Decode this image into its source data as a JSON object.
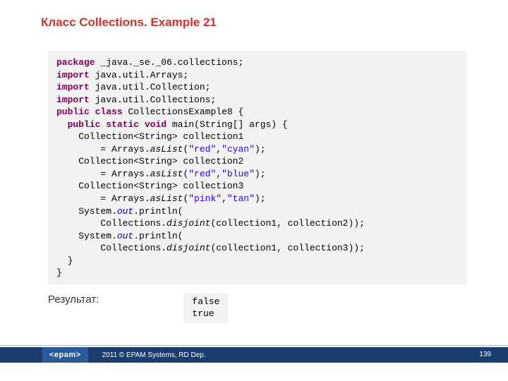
{
  "title": "Класс  Collections. Example 21",
  "code": {
    "l1a": "package",
    "l1b": " _java._se._06.collections;",
    "l2a": "import",
    "l2b": " java.util.Arrays;",
    "l3a": "import",
    "l3b": " java.util.Collection;",
    "l4a": "import",
    "l4b": " java.util.Collections;",
    "l5a": "public",
    "l5b": " ",
    "l5c": "class",
    "l5d": " CollectionsExample8 {",
    "l6a": "  ",
    "l6b": "public",
    "l6c": " ",
    "l6d": "static",
    "l6e": " ",
    "l6f": "void",
    "l6g": " main(String[] args) {",
    "l7": "    Collection<String> collection1",
    "l8a": "        = Arrays.",
    "l8b": "asList",
    "l8c": "(",
    "l8d": "\"red\"",
    "l8e": ",",
    "l8f": "\"cyan\"",
    "l8g": ");",
    "l9": "    Collection<String> collection2",
    "l10a": "        = Arrays.",
    "l10b": "asList",
    "l10c": "(",
    "l10d": "\"red\"",
    "l10e": ",",
    "l10f": "\"blue\"",
    "l10g": ");",
    "l11": "    Collection<String> collection3",
    "l12a": "        = Arrays.",
    "l12b": "asList",
    "l12c": "(",
    "l12d": "\"pink\"",
    "l12e": ",",
    "l12f": "\"tan\"",
    "l12g": ");",
    "l13a": "    System.",
    "l13b": "out",
    "l13c": ".println(",
    "l14a": "        Collections.",
    "l14b": "disjoint",
    "l14c": "(collection1, collection2));",
    "l15a": "    System.",
    "l15b": "out",
    "l15c": ".println(",
    "l16a": "        Collections.",
    "l16b": "disjoint",
    "l16c": "(collection1, collection3));",
    "l17": "  }",
    "l18": "}"
  },
  "result_label": "Результат:",
  "output": "false\ntrue",
  "footer": {
    "logo": "<epam>",
    "copyright": "2011 © EPAM Systems, RD Dep.",
    "page": "139"
  }
}
